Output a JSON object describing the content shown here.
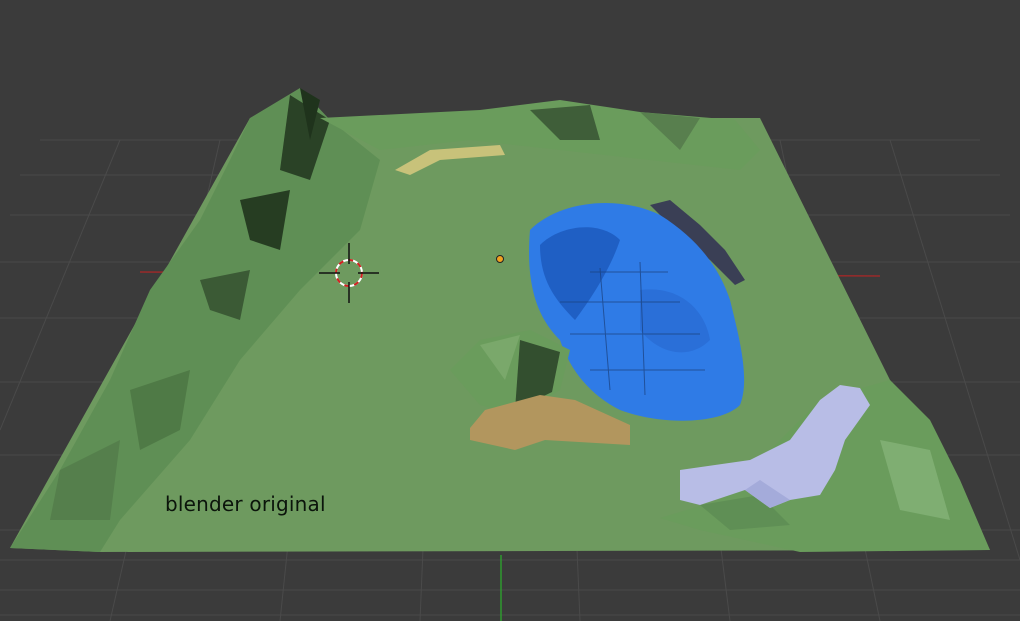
{
  "viewport": {
    "overlay_text": "blender original",
    "colors": {
      "background": "#3b3b3b",
      "grid": "#4a4a4a",
      "grass": "#6e9a5f",
      "hill": "#5f8f55",
      "hill_dark": "#2f4a2a",
      "water": "#2f7be6",
      "water_dark": "#1f5fc4",
      "sand": "#b2965e",
      "path": "#c8c27a",
      "snow": "#b8bde6",
      "rock": "#3a3f55",
      "axis_x": "#9a2a2a",
      "axis_y": "#2e9a2e"
    },
    "icons": [
      "3d-cursor-icon",
      "object-origin-icon"
    ]
  }
}
